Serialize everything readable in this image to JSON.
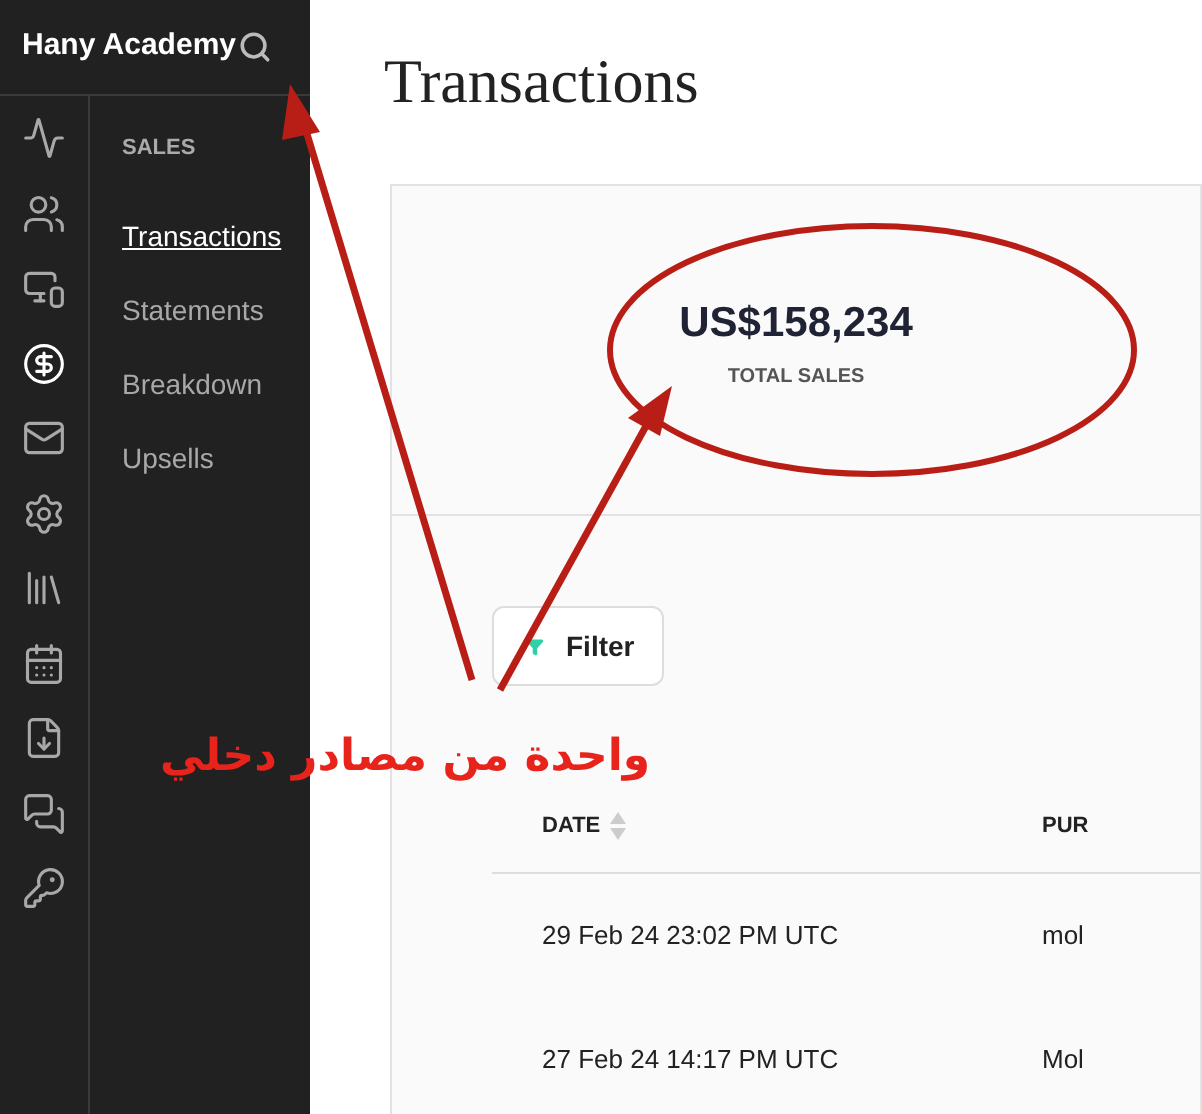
{
  "app": {
    "title": "Hany Academy"
  },
  "rail": [
    {
      "kind": "activity",
      "selected": false
    },
    {
      "kind": "users",
      "selected": false
    },
    {
      "kind": "devices",
      "selected": false
    },
    {
      "kind": "dollar",
      "selected": true
    },
    {
      "kind": "mail",
      "selected": false
    },
    {
      "kind": "settings",
      "selected": false
    },
    {
      "kind": "library",
      "selected": false
    },
    {
      "kind": "calendar",
      "selected": false
    },
    {
      "kind": "download",
      "selected": false
    },
    {
      "kind": "chat",
      "selected": false
    },
    {
      "kind": "key",
      "selected": false
    }
  ],
  "submenu": {
    "heading": "SALES",
    "items": [
      {
        "label": "Transactions",
        "selected": true
      },
      {
        "label": "Statements",
        "selected": false
      },
      {
        "label": "Breakdown",
        "selected": false
      },
      {
        "label": "Upsells",
        "selected": false
      }
    ]
  },
  "page": {
    "title": "Transactions"
  },
  "stat": {
    "value": "US$158,234",
    "label": "TOTAL SALES"
  },
  "filter": {
    "label": "Filter"
  },
  "table": {
    "columns": [
      "DATE",
      "PUR"
    ],
    "rows": [
      [
        "29 Feb 24 23:02 PM UTC",
        "mol"
      ],
      [
        "27 Feb 24 14:17 PM UTC",
        "Mol"
      ]
    ]
  },
  "annotation": {
    "text": "واحدة من مصادر دخلي"
  }
}
